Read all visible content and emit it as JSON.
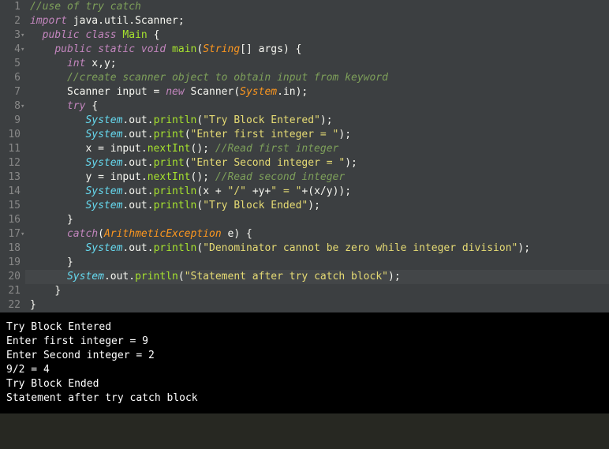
{
  "editor": {
    "lines": [
      {
        "num": "1",
        "tokens": [
          [
            "comment",
            "//use of try catch"
          ]
        ]
      },
      {
        "num": "2",
        "tokens": [
          [
            "keyword",
            "import"
          ],
          [
            "default",
            " java"
          ],
          [
            "punct",
            "."
          ],
          [
            "default",
            "util"
          ],
          [
            "punct",
            "."
          ],
          [
            "default",
            "Scanner"
          ],
          [
            "punct",
            ";"
          ]
        ]
      },
      {
        "num": "3",
        "fold": true,
        "tokens": [
          [
            "default",
            "  "
          ],
          [
            "keyword",
            "public"
          ],
          [
            "default",
            " "
          ],
          [
            "keyword",
            "class"
          ],
          [
            "default",
            " "
          ],
          [
            "classname",
            "Main"
          ],
          [
            "default",
            " "
          ],
          [
            "punct",
            "{"
          ]
        ]
      },
      {
        "num": "4",
        "fold": true,
        "tokens": [
          [
            "default",
            "    "
          ],
          [
            "keyword",
            "public"
          ],
          [
            "default",
            " "
          ],
          [
            "keyword",
            "static"
          ],
          [
            "default",
            " "
          ],
          [
            "type",
            "void"
          ],
          [
            "default",
            " "
          ],
          [
            "method",
            "main"
          ],
          [
            "punct",
            "("
          ],
          [
            "param",
            "String"
          ],
          [
            "punct",
            "[]"
          ],
          [
            "default",
            " "
          ],
          [
            "default",
            "args"
          ],
          [
            "punct",
            ")"
          ],
          [
            "default",
            " "
          ],
          [
            "punct",
            "{"
          ]
        ]
      },
      {
        "num": "5",
        "tokens": [
          [
            "default",
            "      "
          ],
          [
            "type",
            "int"
          ],
          [
            "default",
            " x"
          ],
          [
            "punct",
            ","
          ],
          [
            "default",
            "y"
          ],
          [
            "punct",
            ";"
          ]
        ]
      },
      {
        "num": "6",
        "tokens": [
          [
            "default",
            "      "
          ],
          [
            "comment",
            "//create scanner object to obtain input from keyword"
          ]
        ]
      },
      {
        "num": "7",
        "tokens": [
          [
            "default",
            "      Scanner input "
          ],
          [
            "punct",
            "="
          ],
          [
            "default",
            " "
          ],
          [
            "keyword",
            "new"
          ],
          [
            "default",
            " Scanner"
          ],
          [
            "punct",
            "("
          ],
          [
            "param",
            "System"
          ],
          [
            "punct",
            "."
          ],
          [
            "default",
            "in"
          ],
          [
            "punct",
            ")"
          ],
          [
            "punct",
            ";"
          ]
        ]
      },
      {
        "num": "8",
        "fold": true,
        "tokens": [
          [
            "default",
            "      "
          ],
          [
            "keyword",
            "try"
          ],
          [
            "default",
            " "
          ],
          [
            "punct",
            "{"
          ]
        ]
      },
      {
        "num": "9",
        "tokens": [
          [
            "default",
            "         "
          ],
          [
            "system",
            "System"
          ],
          [
            "punct",
            "."
          ],
          [
            "default",
            "out"
          ],
          [
            "punct",
            "."
          ],
          [
            "method",
            "println"
          ],
          [
            "punct",
            "("
          ],
          [
            "string",
            "\"Try Block Entered\""
          ],
          [
            "punct",
            ")"
          ],
          [
            "punct",
            ";"
          ]
        ]
      },
      {
        "num": "10",
        "tokens": [
          [
            "default",
            "         "
          ],
          [
            "system",
            "System"
          ],
          [
            "punct",
            "."
          ],
          [
            "default",
            "out"
          ],
          [
            "punct",
            "."
          ],
          [
            "method",
            "print"
          ],
          [
            "punct",
            "("
          ],
          [
            "string",
            "\"Enter first integer = \""
          ],
          [
            "punct",
            ")"
          ],
          [
            "punct",
            ";"
          ]
        ]
      },
      {
        "num": "11",
        "tokens": [
          [
            "default",
            "         x "
          ],
          [
            "punct",
            "="
          ],
          [
            "default",
            " input"
          ],
          [
            "punct",
            "."
          ],
          [
            "method",
            "nextInt"
          ],
          [
            "punct",
            "("
          ],
          [
            "punct",
            ")"
          ],
          [
            "punct",
            ";"
          ],
          [
            "default",
            " "
          ],
          [
            "comment",
            "//Read first integer"
          ]
        ]
      },
      {
        "num": "12",
        "tokens": [
          [
            "default",
            "         "
          ],
          [
            "system",
            "System"
          ],
          [
            "punct",
            "."
          ],
          [
            "default",
            "out"
          ],
          [
            "punct",
            "."
          ],
          [
            "method",
            "print"
          ],
          [
            "punct",
            "("
          ],
          [
            "string",
            "\"Enter Second integer = \""
          ],
          [
            "punct",
            ")"
          ],
          [
            "punct",
            ";"
          ]
        ]
      },
      {
        "num": "13",
        "tokens": [
          [
            "default",
            "         y "
          ],
          [
            "punct",
            "="
          ],
          [
            "default",
            " input"
          ],
          [
            "punct",
            "."
          ],
          [
            "method",
            "nextInt"
          ],
          [
            "punct",
            "("
          ],
          [
            "punct",
            ")"
          ],
          [
            "punct",
            ";"
          ],
          [
            "default",
            " "
          ],
          [
            "comment",
            "//Read second integer"
          ]
        ]
      },
      {
        "num": "14",
        "tokens": [
          [
            "default",
            "         "
          ],
          [
            "system",
            "System"
          ],
          [
            "punct",
            "."
          ],
          [
            "default",
            "out"
          ],
          [
            "punct",
            "."
          ],
          [
            "method",
            "println"
          ],
          [
            "punct",
            "("
          ],
          [
            "default",
            "x "
          ],
          [
            "punct",
            "+"
          ],
          [
            "default",
            " "
          ],
          [
            "string",
            "\"/\""
          ],
          [
            "default",
            " "
          ],
          [
            "punct",
            "+"
          ],
          [
            "default",
            "y"
          ],
          [
            "punct",
            "+"
          ],
          [
            "string",
            "\" = \""
          ],
          [
            "punct",
            "+"
          ],
          [
            "punct",
            "("
          ],
          [
            "default",
            "x"
          ],
          [
            "punct",
            "/"
          ],
          [
            "default",
            "y"
          ],
          [
            "punct",
            ")"
          ],
          [
            "punct",
            ")"
          ],
          [
            "punct",
            ";"
          ]
        ]
      },
      {
        "num": "15",
        "tokens": [
          [
            "default",
            "         "
          ],
          [
            "system",
            "System"
          ],
          [
            "punct",
            "."
          ],
          [
            "default",
            "out"
          ],
          [
            "punct",
            "."
          ],
          [
            "method",
            "println"
          ],
          [
            "punct",
            "("
          ],
          [
            "string",
            "\"Try Block Ended\""
          ],
          [
            "punct",
            ")"
          ],
          [
            "punct",
            ";"
          ]
        ]
      },
      {
        "num": "16",
        "tokens": [
          [
            "default",
            "      "
          ],
          [
            "punct",
            "}"
          ]
        ]
      },
      {
        "num": "17",
        "fold": true,
        "tokens": [
          [
            "default",
            "      "
          ],
          [
            "keyword",
            "catch"
          ],
          [
            "punct",
            "("
          ],
          [
            "exception",
            "ArithmeticException"
          ],
          [
            "default",
            " e"
          ],
          [
            "punct",
            ")"
          ],
          [
            "default",
            " "
          ],
          [
            "punct",
            "{"
          ]
        ]
      },
      {
        "num": "18",
        "tokens": [
          [
            "default",
            "         "
          ],
          [
            "system",
            "System"
          ],
          [
            "punct",
            "."
          ],
          [
            "default",
            "out"
          ],
          [
            "punct",
            "."
          ],
          [
            "method",
            "println"
          ],
          [
            "punct",
            "("
          ],
          [
            "string",
            "\"Denominator cannot be zero while integer division\""
          ],
          [
            "punct",
            ")"
          ],
          [
            "punct",
            ";"
          ]
        ]
      },
      {
        "num": "19",
        "tokens": [
          [
            "default",
            "      "
          ],
          [
            "punct",
            "}"
          ]
        ]
      },
      {
        "num": "20",
        "hl": true,
        "tokens": [
          [
            "default",
            "      "
          ],
          [
            "system",
            "System"
          ],
          [
            "punct",
            "."
          ],
          [
            "default",
            "out"
          ],
          [
            "punct",
            "."
          ],
          [
            "method",
            "println"
          ],
          [
            "punct",
            "("
          ],
          [
            "string",
            "\"Statement after try catch block\""
          ],
          [
            "punct",
            ")"
          ],
          [
            "punct",
            ";"
          ]
        ]
      },
      {
        "num": "21",
        "tokens": [
          [
            "default",
            "    "
          ],
          [
            "punct",
            "}"
          ]
        ]
      },
      {
        "num": "22",
        "tokens": [
          [
            "punct",
            "}"
          ]
        ]
      }
    ]
  },
  "terminal": {
    "output": "Try Block Entered\nEnter first integer = 9\nEnter Second integer = 2\n9/2 = 4\nTry Block Ended\nStatement after try catch block"
  }
}
